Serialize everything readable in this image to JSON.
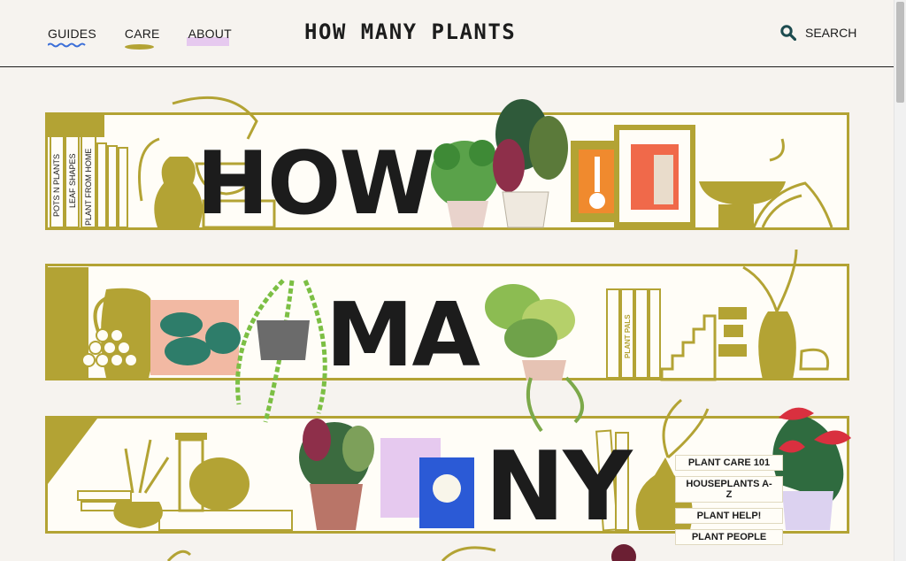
{
  "header": {
    "nav": [
      {
        "label": "GUIDES"
      },
      {
        "label": "CARE"
      },
      {
        "label": "ABOUT"
      }
    ],
    "logo": "HOW MANY PLANTS",
    "search_label": "SEARCH"
  },
  "hero": {
    "word_1": "HOW",
    "word_2": "MA",
    "word_3": "NY",
    "book_spines": [
      "POTS N PLANTS",
      "LEAF SHAPES",
      "PLANT FROM HOME"
    ],
    "plant_pals_label": "PLANT PALS",
    "side_menu": [
      {
        "label": "PLANT CARE 101"
      },
      {
        "label": "HOUSEPLANTS A-Z"
      },
      {
        "label": "PLANT HELP!"
      },
      {
        "label": "PLANT PEOPLE"
      }
    ]
  },
  "colors": {
    "accent_olive": "#b3a334",
    "ink": "#1c1c1c",
    "background": "#f6f3ef",
    "wave_blue": "#3a6ed8",
    "lilac": "#e6c9ef",
    "search_icon": "#1c4b4f"
  }
}
